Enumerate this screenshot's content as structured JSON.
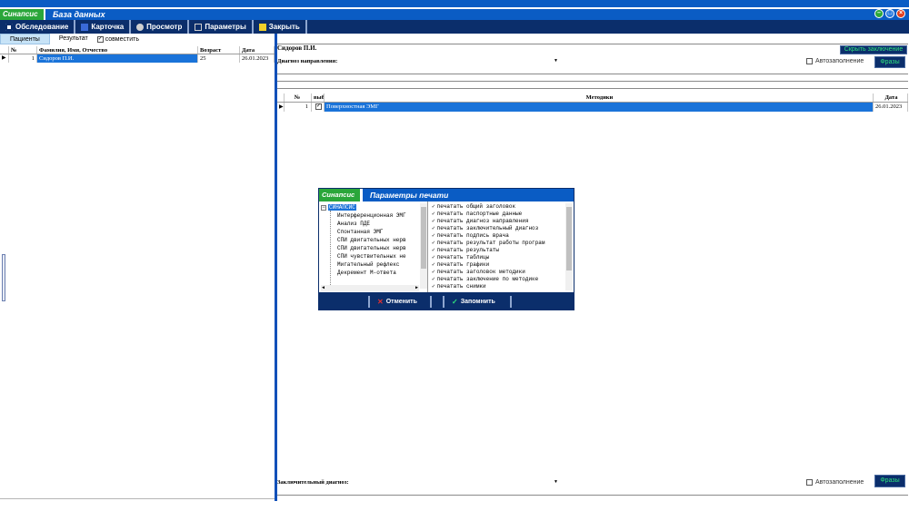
{
  "window": {
    "logo": "Синапсис",
    "title": "База данных"
  },
  "toolbar": {
    "exam": "Обследование",
    "card": "Карточка",
    "view": "Просмотр",
    "params": "Параметры",
    "close": "Закрыть"
  },
  "left": {
    "tabs": [
      "Пациенты",
      "Результат"
    ],
    "combine_label": "совместить",
    "columns": [
      "№",
      "Фамилия, Имя, Отчество",
      "Возраст",
      "Дата"
    ],
    "rows": [
      {
        "num": "1",
        "name": "Сидоров П.И.",
        "age": "25",
        "date": "26.01.2023"
      }
    ]
  },
  "right": {
    "patient_name": "Сидоров П.И.",
    "hide_conclusion": "Скрыть заключение",
    "referral_label": "Диагноз направления:",
    "autofill_label": "Автозаполнение",
    "phrases_label": "Фразы",
    "methods_columns": [
      "№",
      "выб",
      "Методики",
      "Дата"
    ],
    "methods_rows": [
      {
        "num": "1",
        "method": "Поверхностная ЭМГ",
        "date": "26.01.2023"
      }
    ],
    "final_label": "Заключительный диагноз:"
  },
  "dialog": {
    "logo": "Синапсис",
    "title": "Параметры печати",
    "tree_root": "СИНАПСИС",
    "tree_items": [
      "Интерференционная ЭМГ",
      "Анализ ПДЕ",
      "Спонтанная ЭМГ",
      "СПИ двигательных нерв",
      "СПИ двигательных нерв",
      "СПИ чувствительных не",
      "Мигательный рефлекс",
      "Декремент М-ответа"
    ],
    "options": [
      "печатать общий заголовок",
      "печатать паспортные данные",
      "печатать диагноз направления",
      "печатать заключительный диагноз",
      "печатать подпись врача",
      "печатать результат работы програм",
      "печатать результаты",
      "печатать таблицы",
      "печатать графики",
      "печатать заголовок методики",
      "печатать заключение по методике",
      "печатать снимки"
    ],
    "cancel": "Отменить",
    "save": "Запомнить"
  }
}
